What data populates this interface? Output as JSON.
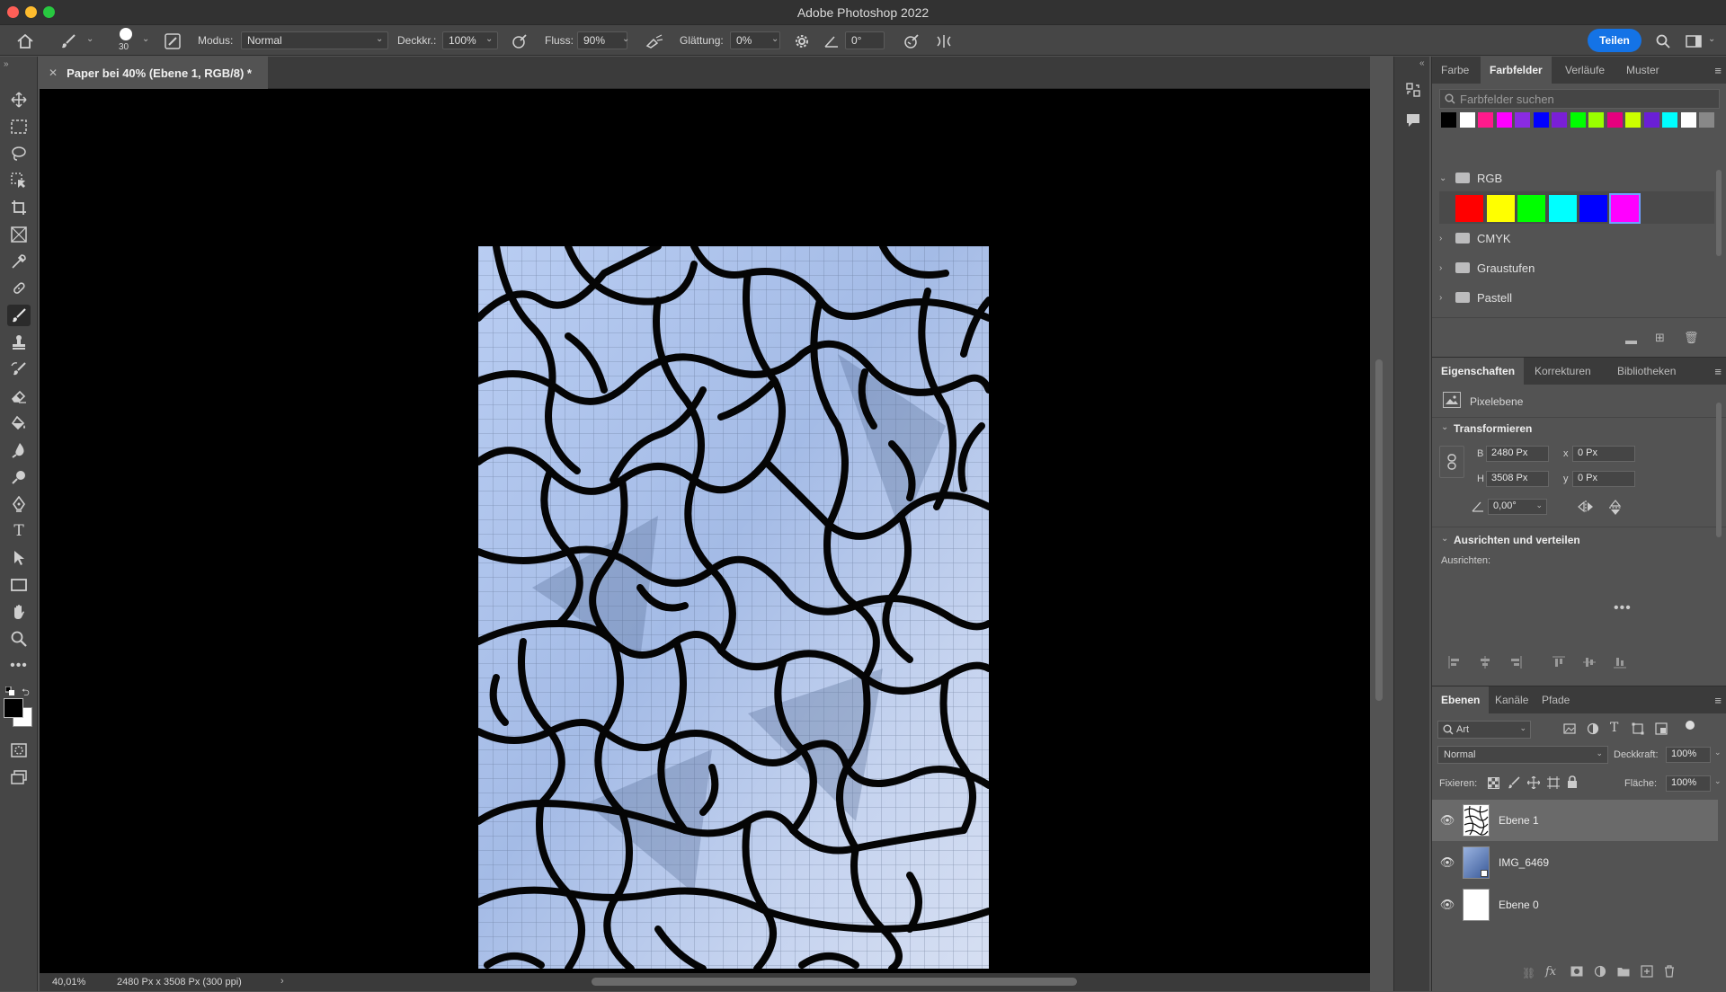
{
  "window": {
    "title": "Adobe Photoshop 2022"
  },
  "options_bar": {
    "brush_size": "30",
    "mode_label": "Modus:",
    "mode_value": "Normal",
    "opacity_label": "Deckkr.:",
    "opacity_value": "100%",
    "flow_label": "Fluss:",
    "flow_value": "90%",
    "smoothing_label": "Glättung:",
    "smoothing_value": "0%",
    "angle_value": "0°",
    "share_label": "Teilen"
  },
  "document_tab": {
    "title": "Paper bei 40% (Ebene 1, RGB/8) *"
  },
  "status_bar": {
    "zoom": "40,01%",
    "doc_size": "2480 Px x 3508 Px (300 ppi)"
  },
  "swatches_panel": {
    "tabs": [
      "Farbe",
      "Farbfelder",
      "Verläufe",
      "Muster"
    ],
    "active_tab": "Farbfelder",
    "search_placeholder": "Farbfelder suchen",
    "recent_colors": [
      "#000000",
      "#ffffff",
      "#ff1a8c",
      "#ff00ff",
      "#8a2be2",
      "#0000ff",
      "#7a1fd6",
      "#00ff00",
      "#99ff00",
      "#e6007e",
      "#ccff00",
      "#6a1fd6",
      "#00ffff",
      "#ffffff",
      "#888888"
    ],
    "groups": [
      {
        "name": "RGB",
        "expanded": true,
        "colors": [
          "#ff0000",
          "#ffff00",
          "#00ff00",
          "#00ffff",
          "#0000ff",
          "#ff00ff"
        ]
      },
      {
        "name": "CMYK",
        "expanded": false
      },
      {
        "name": "Graustufen",
        "expanded": false
      },
      {
        "name": "Pastell",
        "expanded": false
      }
    ]
  },
  "properties_panel": {
    "tabs": [
      "Eigenschaften",
      "Korrekturen",
      "Bibliotheken"
    ],
    "active_tab": "Eigenschaften",
    "layer_type": "Pixelebene",
    "transform_title": "Transformieren",
    "w_label": "B",
    "w_value": "2480 Px",
    "h_label": "H",
    "h_value": "3508 Px",
    "x_label": "x",
    "x_value": "0 Px",
    "y_label": "y",
    "y_value": "0 Px",
    "angle_value": "0,00°",
    "align_title": "Ausrichten und verteilen",
    "align_label": "Ausrichten:"
  },
  "layers_panel": {
    "tabs": [
      "Ebenen",
      "Kanäle",
      "Pfade"
    ],
    "active_tab": "Ebenen",
    "filter_value": "Art",
    "blend_mode": "Normal",
    "opacity_label": "Deckkraft:",
    "opacity_value": "100%",
    "lock_label": "Fixieren:",
    "fill_label": "Fläche:",
    "fill_value": "100%",
    "layers": [
      {
        "name": "Ebene 1",
        "visible": true,
        "selected": true
      },
      {
        "name": "IMG_6469",
        "visible": true,
        "selected": false
      },
      {
        "name": "Ebene 0",
        "visible": true,
        "selected": false
      }
    ]
  },
  "colors": {
    "accent": "#1473e6",
    "foreground": "#000000",
    "background": "#ffffff"
  }
}
